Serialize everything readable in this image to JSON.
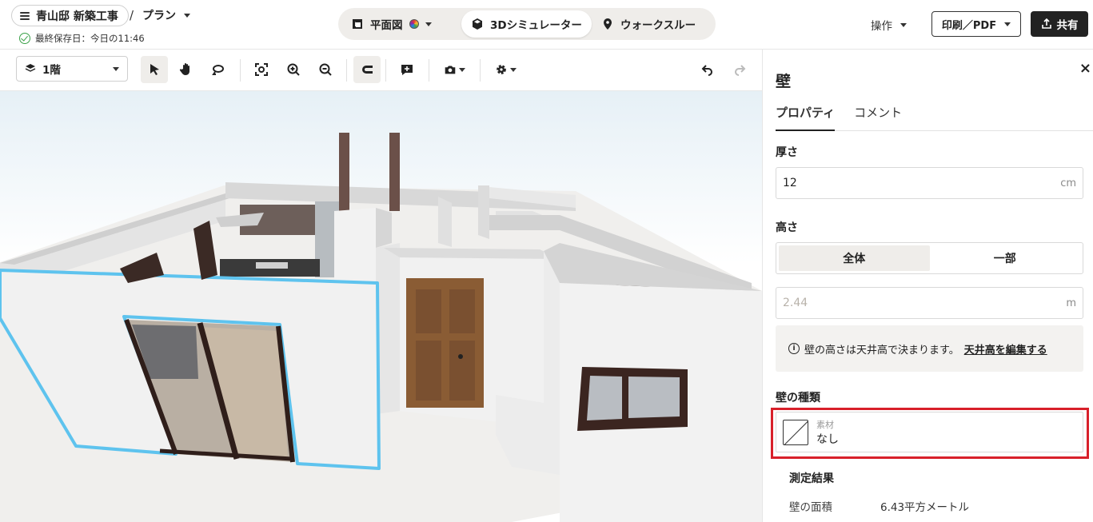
{
  "header": {
    "project": "青山邸 新築工事",
    "separator": "/",
    "plan": "プラン",
    "saved": "最終保存日：今日の11:46",
    "modes": [
      {
        "label": "平面図",
        "icon": "floorplan-icon",
        "active": false
      },
      {
        "label": "3Dシミュレーター",
        "icon": "cube-icon",
        "active": true
      },
      {
        "label": "ウォークスルー",
        "icon": "location-pin-icon",
        "active": false
      }
    ],
    "operations": "操作",
    "print": "印刷／PDF",
    "share": "共有"
  },
  "toolbar": {
    "floor": "1階",
    "tools": [
      "select-arrow-icon",
      "hand-pan-icon",
      "orbit-icon",
      "fit-view-icon",
      "zoom-in-icon",
      "zoom-out-icon",
      "snap-magnet-icon",
      "add-comment-icon",
      "camera-icon",
      "settings-gear-icon",
      "undo-icon",
      "redo-icon"
    ]
  },
  "panel": {
    "title": "壁",
    "close": "×",
    "tabs": [
      "プロパティ",
      "コメント"
    ],
    "thickness": {
      "label": "厚さ",
      "value": "12",
      "unit": "cm"
    },
    "height": {
      "label": "高さ",
      "options": [
        "全体",
        "一部"
      ],
      "value": "2.44",
      "unit": "m"
    },
    "info": {
      "text": "壁の高さは天井高で決まります。",
      "link": "天井高を編集する"
    },
    "wall_type": {
      "label": "壁の種類",
      "sub": "素材",
      "value": "なし"
    },
    "measure": {
      "title": "測定結果",
      "key": "壁の面積",
      "value": "6.43平方メートル"
    }
  },
  "colors": {
    "accent": "#222222",
    "selection": "#5ec3ee",
    "highlight": "#d8202a"
  }
}
